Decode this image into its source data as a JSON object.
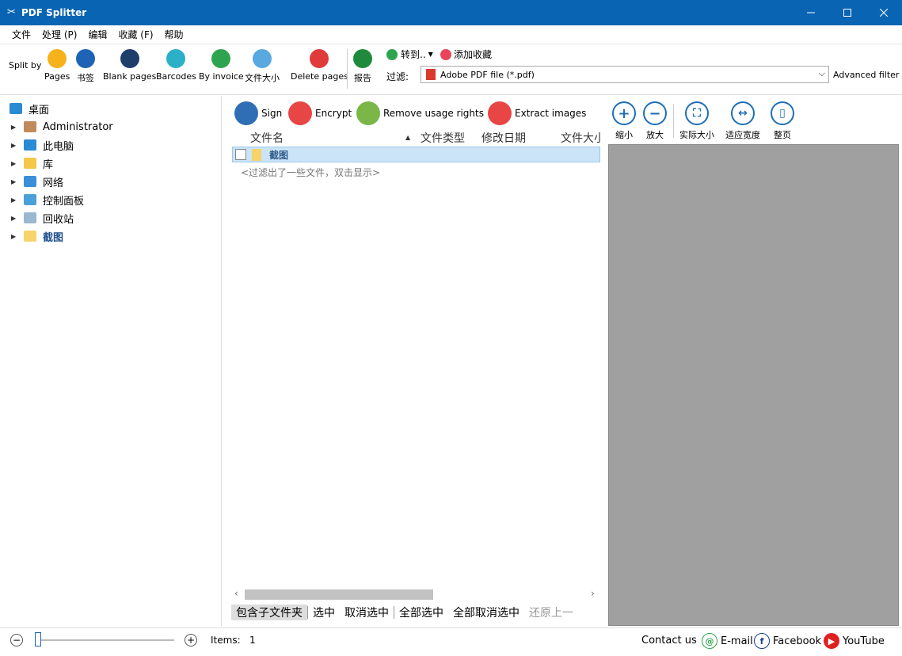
{
  "window": {
    "title": "PDF Splitter"
  },
  "menu": [
    "文件",
    "处理 (P)",
    "编辑",
    "收藏 (F)",
    "帮助"
  ],
  "toolbar": {
    "split_by": "Split by",
    "buttons": [
      {
        "label": "Pages",
        "color": "#f5b21a"
      },
      {
        "label": "书签",
        "color": "#1e63b5"
      },
      {
        "label": "Blank pages",
        "color": "#1f3f6b"
      },
      {
        "label": "Barcodes",
        "color": "#2bb0c8"
      },
      {
        "label": "By invoice",
        "color": "#2ea44f"
      },
      {
        "label": "文件大小",
        "color": "#5aa8e0"
      },
      {
        "label": "Delete pages",
        "color": "#e03a3a"
      },
      {
        "label": "报告",
        "color": "#1f8a3b"
      }
    ],
    "goto": "转到..",
    "add_favorite": "添加收藏",
    "filter_label": "过滤:",
    "filter_value": "Adobe PDF file (*.pdf)",
    "advanced_filter": "Advanced filter"
  },
  "tree": [
    {
      "label": "桌面",
      "expandable": false,
      "bold": false
    },
    {
      "label": "Administrator",
      "expandable": true,
      "bold": false
    },
    {
      "label": "此电脑",
      "expandable": true,
      "bold": false
    },
    {
      "label": "库",
      "expandable": true,
      "bold": false
    },
    {
      "label": "网络",
      "expandable": true,
      "bold": false
    },
    {
      "label": "控制面板",
      "expandable": true,
      "bold": false
    },
    {
      "label": "回收站",
      "expandable": true,
      "bold": false
    },
    {
      "label": "截图",
      "expandable": true,
      "bold": true
    }
  ],
  "actions": [
    {
      "label": "Sign",
      "color": "#2f6db5"
    },
    {
      "label": "Encrypt",
      "color": "#e84545"
    },
    {
      "label": "Remove usage rights",
      "color": "#7ab648"
    },
    {
      "label": "Extract images",
      "color": "#e84545"
    }
  ],
  "columns": [
    "文件名",
    "文件类型",
    "修改日期",
    "文件大小"
  ],
  "files": [
    {
      "name": "截图"
    }
  ],
  "filtered_hint": "<过滤出了一些文件，双击显示>",
  "bottom_actions": [
    "包含子文件夹",
    "选中",
    "取消选中",
    "全部选中",
    "全部取消选中",
    "还原上一"
  ],
  "viewer": [
    "缩小",
    "放大",
    "实际大小",
    "适应宽度",
    "整页"
  ],
  "status": {
    "items_label": "Items:",
    "items_count": "1",
    "contact": "Contact us",
    "email": "E-mail",
    "facebook": "Facebook",
    "youtube": "YouTube"
  }
}
